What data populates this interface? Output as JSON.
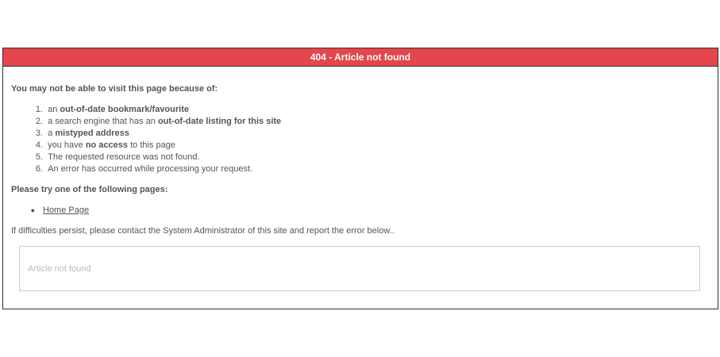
{
  "header": {
    "title": "404 - Article not found"
  },
  "reasons": {
    "heading": "You may not be able to visit this page because of:",
    "items": [
      {
        "num": "1.",
        "pre": "an ",
        "bold": "out-of-date bookmark/favourite",
        "post": ""
      },
      {
        "num": "2.",
        "pre": "a search engine that has an ",
        "bold": "out-of-date listing for this site",
        "post": ""
      },
      {
        "num": "3.",
        "pre": "a ",
        "bold": "mistyped address",
        "post": ""
      },
      {
        "num": "4.",
        "pre": "you have ",
        "bold": "no access",
        "post": " to this page"
      },
      {
        "num": "5.",
        "pre": "The requested resource was not found.",
        "bold": "",
        "post": ""
      },
      {
        "num": "6.",
        "pre": "An error has occurred while processing your request.",
        "bold": "",
        "post": ""
      }
    ]
  },
  "pages": {
    "heading": "Please try one of the following pages:",
    "bullet": "●",
    "links": [
      {
        "label": "Home Page"
      }
    ]
  },
  "footer": {
    "persist_text": "If difficulties persist, please contact the System Administrator of this site and report the error below.."
  },
  "error_message": {
    "text": "Article not found"
  }
}
